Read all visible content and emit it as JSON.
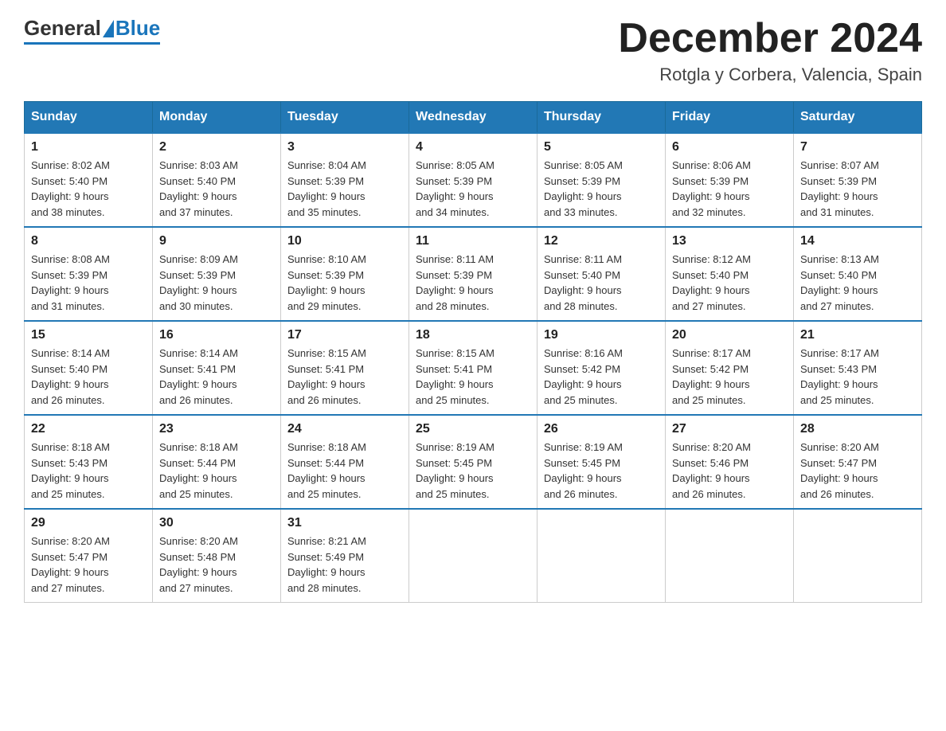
{
  "header": {
    "logo_general": "General",
    "logo_blue": "Blue",
    "month_title": "December 2024",
    "location": "Rotgla y Corbera, Valencia, Spain"
  },
  "days_of_week": [
    "Sunday",
    "Monday",
    "Tuesday",
    "Wednesday",
    "Thursday",
    "Friday",
    "Saturday"
  ],
  "weeks": [
    [
      {
        "day": "1",
        "sunrise": "8:02 AM",
        "sunset": "5:40 PM",
        "daylight": "9 hours and 38 minutes."
      },
      {
        "day": "2",
        "sunrise": "8:03 AM",
        "sunset": "5:40 PM",
        "daylight": "9 hours and 37 minutes."
      },
      {
        "day": "3",
        "sunrise": "8:04 AM",
        "sunset": "5:39 PM",
        "daylight": "9 hours and 35 minutes."
      },
      {
        "day": "4",
        "sunrise": "8:05 AM",
        "sunset": "5:39 PM",
        "daylight": "9 hours and 34 minutes."
      },
      {
        "day": "5",
        "sunrise": "8:05 AM",
        "sunset": "5:39 PM",
        "daylight": "9 hours and 33 minutes."
      },
      {
        "day": "6",
        "sunrise": "8:06 AM",
        "sunset": "5:39 PM",
        "daylight": "9 hours and 32 minutes."
      },
      {
        "day": "7",
        "sunrise": "8:07 AM",
        "sunset": "5:39 PM",
        "daylight": "9 hours and 31 minutes."
      }
    ],
    [
      {
        "day": "8",
        "sunrise": "8:08 AM",
        "sunset": "5:39 PM",
        "daylight": "9 hours and 31 minutes."
      },
      {
        "day": "9",
        "sunrise": "8:09 AM",
        "sunset": "5:39 PM",
        "daylight": "9 hours and 30 minutes."
      },
      {
        "day": "10",
        "sunrise": "8:10 AM",
        "sunset": "5:39 PM",
        "daylight": "9 hours and 29 minutes."
      },
      {
        "day": "11",
        "sunrise": "8:11 AM",
        "sunset": "5:39 PM",
        "daylight": "9 hours and 28 minutes."
      },
      {
        "day": "12",
        "sunrise": "8:11 AM",
        "sunset": "5:40 PM",
        "daylight": "9 hours and 28 minutes."
      },
      {
        "day": "13",
        "sunrise": "8:12 AM",
        "sunset": "5:40 PM",
        "daylight": "9 hours and 27 minutes."
      },
      {
        "day": "14",
        "sunrise": "8:13 AM",
        "sunset": "5:40 PM",
        "daylight": "9 hours and 27 minutes."
      }
    ],
    [
      {
        "day": "15",
        "sunrise": "8:14 AM",
        "sunset": "5:40 PM",
        "daylight": "9 hours and 26 minutes."
      },
      {
        "day": "16",
        "sunrise": "8:14 AM",
        "sunset": "5:41 PM",
        "daylight": "9 hours and 26 minutes."
      },
      {
        "day": "17",
        "sunrise": "8:15 AM",
        "sunset": "5:41 PM",
        "daylight": "9 hours and 26 minutes."
      },
      {
        "day": "18",
        "sunrise": "8:15 AM",
        "sunset": "5:41 PM",
        "daylight": "9 hours and 25 minutes."
      },
      {
        "day": "19",
        "sunrise": "8:16 AM",
        "sunset": "5:42 PM",
        "daylight": "9 hours and 25 minutes."
      },
      {
        "day": "20",
        "sunrise": "8:17 AM",
        "sunset": "5:42 PM",
        "daylight": "9 hours and 25 minutes."
      },
      {
        "day": "21",
        "sunrise": "8:17 AM",
        "sunset": "5:43 PM",
        "daylight": "9 hours and 25 minutes."
      }
    ],
    [
      {
        "day": "22",
        "sunrise": "8:18 AM",
        "sunset": "5:43 PM",
        "daylight": "9 hours and 25 minutes."
      },
      {
        "day": "23",
        "sunrise": "8:18 AM",
        "sunset": "5:44 PM",
        "daylight": "9 hours and 25 minutes."
      },
      {
        "day": "24",
        "sunrise": "8:18 AM",
        "sunset": "5:44 PM",
        "daylight": "9 hours and 25 minutes."
      },
      {
        "day": "25",
        "sunrise": "8:19 AM",
        "sunset": "5:45 PM",
        "daylight": "9 hours and 25 minutes."
      },
      {
        "day": "26",
        "sunrise": "8:19 AM",
        "sunset": "5:45 PM",
        "daylight": "9 hours and 26 minutes."
      },
      {
        "day": "27",
        "sunrise": "8:20 AM",
        "sunset": "5:46 PM",
        "daylight": "9 hours and 26 minutes."
      },
      {
        "day": "28",
        "sunrise": "8:20 AM",
        "sunset": "5:47 PM",
        "daylight": "9 hours and 26 minutes."
      }
    ],
    [
      {
        "day": "29",
        "sunrise": "8:20 AM",
        "sunset": "5:47 PM",
        "daylight": "9 hours and 27 minutes."
      },
      {
        "day": "30",
        "sunrise": "8:20 AM",
        "sunset": "5:48 PM",
        "daylight": "9 hours and 27 minutes."
      },
      {
        "day": "31",
        "sunrise": "8:21 AM",
        "sunset": "5:49 PM",
        "daylight": "9 hours and 28 minutes."
      },
      null,
      null,
      null,
      null
    ]
  ]
}
